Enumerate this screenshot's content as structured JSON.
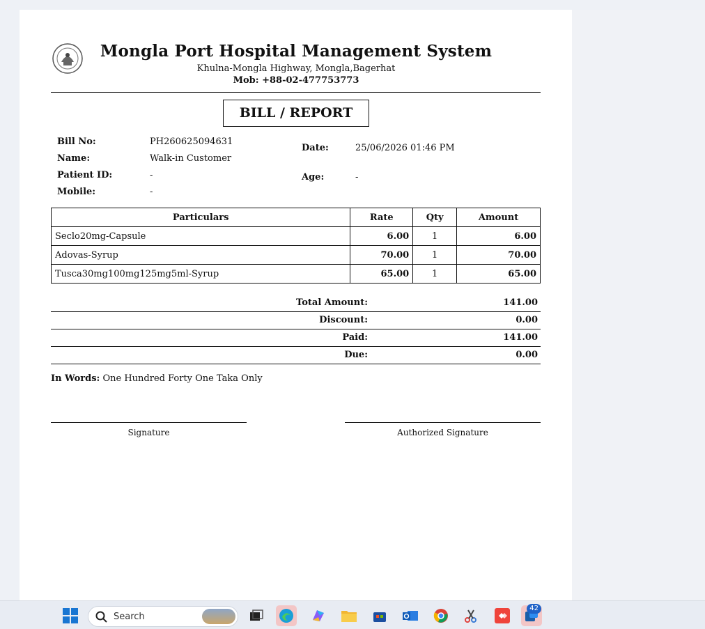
{
  "header": {
    "title": "Mongla Port Hospital Management System",
    "address": "Khulna-Mongla Highway, Mongla,Bagerhat",
    "mobile": "Mob: +88-02-477753773"
  },
  "bill_heading": "BILL / REPORT",
  "info": {
    "bill_no_label": "Bill No:",
    "bill_no": "PH260625094631",
    "name_label": "Name:",
    "name": "Walk-in Customer",
    "patient_id_label": "Patient ID:",
    "patient_id": "-",
    "mobile_label": "Mobile:",
    "mobile": "-",
    "date_label": "Date:",
    "date": "25/06/2026 01:46 PM",
    "age_label": "Age:",
    "age": "-"
  },
  "table": {
    "headers": [
      "Particulars",
      "Rate",
      "Qty",
      "Amount"
    ],
    "rows": [
      {
        "particular": "Seclo20mg-Capsule",
        "rate": "6.00",
        "qty": "1",
        "amount": "6.00"
      },
      {
        "particular": "Adovas-Syrup",
        "rate": "70.00",
        "qty": "1",
        "amount": "70.00"
      },
      {
        "particular": "Tusca30mg100mg125mg5ml-Syrup",
        "rate": "65.00",
        "qty": "1",
        "amount": "65.00"
      }
    ]
  },
  "totals": {
    "total_label": "Total Amount:",
    "total": "141.00",
    "discount_label": "Discount:",
    "discount": "0.00",
    "paid_label": "Paid:",
    "paid": "141.00",
    "due_label": "Due:",
    "due": "0.00"
  },
  "in_words_label": "In Words:",
  "in_words": "One Hundred Forty One Taka Only",
  "signatures": {
    "left": "Signature",
    "right": "Authorized Signature"
  },
  "taskbar": {
    "search_placeholder": "Search",
    "notification_count": "42"
  }
}
